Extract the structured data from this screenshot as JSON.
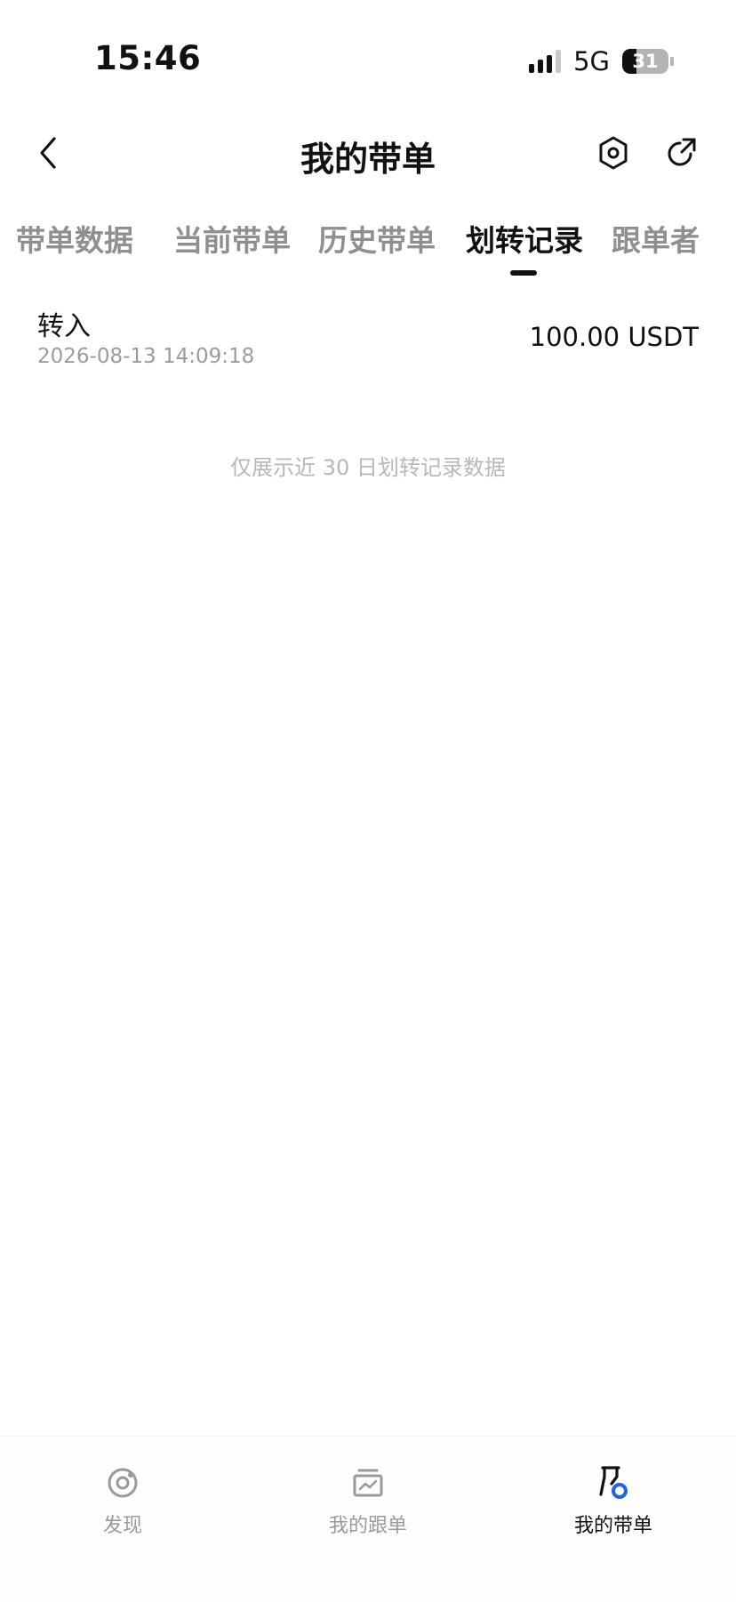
{
  "status_bar": {
    "time": "15:46",
    "network": "5G",
    "battery": "31",
    "battery_level": 0.31
  },
  "header": {
    "title": "我的带单"
  },
  "tabs": [
    {
      "label": "带单数据",
      "active": false
    },
    {
      "label": "当前带单",
      "active": false
    },
    {
      "label": "历史带单",
      "active": false
    },
    {
      "label": "划转记录",
      "active": true
    },
    {
      "label": "跟单者",
      "active": false
    }
  ],
  "records": [
    {
      "type": "转入",
      "time": "2026-08-13 14:09:18",
      "amount": "100.00 USDT"
    }
  ],
  "footer_note": "仅展示近 30 日划转记录数据",
  "bottom_nav": [
    {
      "label": "发现",
      "icon": "discover-icon",
      "active": false
    },
    {
      "label": "我的跟单",
      "icon": "chart-card-icon",
      "active": false
    },
    {
      "label": "我的带单",
      "icon": "lead-trade-icon",
      "active": true
    }
  ],
  "colors": {
    "text_primary": "#111111",
    "text_muted": "#8f8f8f",
    "accent_blue": "#1f63e6"
  }
}
